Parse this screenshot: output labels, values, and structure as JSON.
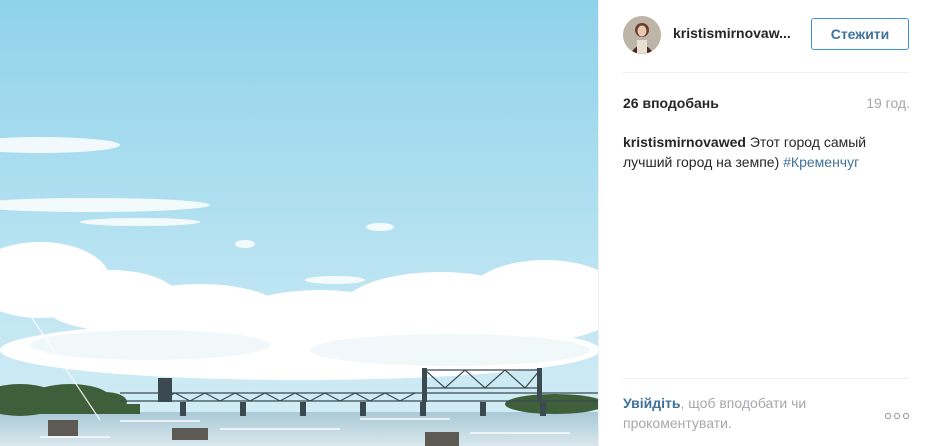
{
  "post": {
    "username": "kristismirnovaw...",
    "follow_label": "Стежити",
    "likes": "26 вподобань",
    "time_ago": "19 год.",
    "caption_user": "kristismirnovawed",
    "caption_text": " Этот город самый лучший город на земпе) ",
    "hashtag": "#Кременчуг",
    "login_link": "Увійдіть",
    "login_prompt": ", щоб вподобати чи прокоментувати.",
    "more_icon": "ellipsis-icon"
  },
  "colors": {
    "link": "#3f729b",
    "button_border": "#4090db",
    "muted": "#a5a7aa",
    "text": "#262626"
  }
}
